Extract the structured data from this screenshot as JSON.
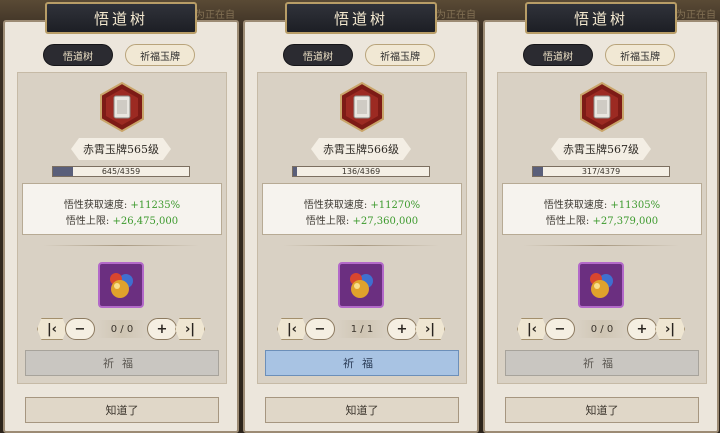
{
  "colors": {
    "accent_green": "#3c9a2d",
    "active_button": "#a8c3e3",
    "disabled_button": "#c9c6c1"
  },
  "background_text": "为正在自",
  "panels": [
    {
      "title": "悟道树",
      "tabs": [
        "悟道树",
        "祈福玉牌"
      ],
      "level": "赤霄玉牌565级",
      "progress_text": "645/4359",
      "progress_fraction": 0.148,
      "speed_label": "悟性获取速度:",
      "speed_value": "+11235%",
      "cap_label": "悟性上限:",
      "cap_value": "+26,475,000",
      "qty": "0 / 0",
      "pray_label": "祈福",
      "pray_active": false,
      "ok_label": "知道了"
    },
    {
      "title": "悟道树",
      "tabs": [
        "悟道树",
        "祈福玉牌"
      ],
      "level": "赤霄玉牌566级",
      "progress_text": "136/4369",
      "progress_fraction": 0.031,
      "speed_label": "悟性获取速度:",
      "speed_value": "+11270%",
      "cap_label": "悟性上限:",
      "cap_value": "+27,360,000",
      "qty": "1 / 1",
      "pray_label": "祈福",
      "pray_active": true,
      "ok_label": "知道了"
    },
    {
      "title": "悟道树",
      "tabs": [
        "悟道树",
        "祈福玉牌"
      ],
      "level": "赤霄玉牌567级",
      "progress_text": "317/4379",
      "progress_fraction": 0.072,
      "speed_label": "悟性获取速度:",
      "speed_value": "+11305%",
      "cap_label": "悟性上限:",
      "cap_value": "+27,379,000",
      "qty": "0 / 0",
      "pray_label": "祈福",
      "pray_active": false,
      "ok_label": "知道了"
    }
  ],
  "icons": {
    "emblem": "jade-token-icon",
    "item": "orb-cluster-icon",
    "first": "skip-first-icon",
    "minus": "minus-icon",
    "plus": "plus-icon",
    "last": "skip-last-icon"
  }
}
